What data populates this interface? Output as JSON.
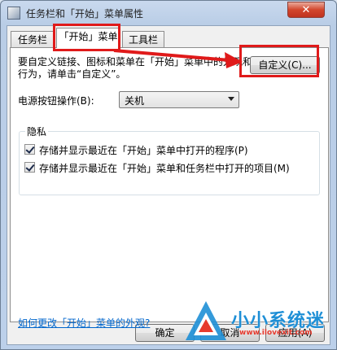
{
  "window": {
    "title": "任务栏和「开始」菜单属性",
    "close_label": "✕"
  },
  "tabs": [
    {
      "label": "任务栏",
      "active": false
    },
    {
      "label": "「开始」菜单",
      "active": true
    },
    {
      "label": "工具栏",
      "active": false
    }
  ],
  "start_menu": {
    "description": "要自定义链接、图标和菜单在「开始」菜单中的外观和行为，请单击“自定义”。",
    "customize_button": "自定义(C)...",
    "power_label": "电源按钮操作(B):",
    "power_value": "关机",
    "privacy": {
      "title": "隐私",
      "items": [
        {
          "label": "存储并显示最近在「开始」菜单中打开的程序(P)",
          "checked": true
        },
        {
          "label": "存储并显示最近在「开始」菜单和任务栏中打开的项目(M)",
          "checked": true
        }
      ]
    },
    "help_link": "如何更改「开始」菜单的外观?"
  },
  "footer": {
    "ok_button": "确定",
    "cancel_button": "取消",
    "apply_button": "应用(A)"
  },
  "watermark": {
    "brand": "小小系统迷",
    "url": "www.ilovexit.com"
  },
  "colors": {
    "annotation_red": "#e01a1a",
    "link_blue": "#0066cc"
  }
}
